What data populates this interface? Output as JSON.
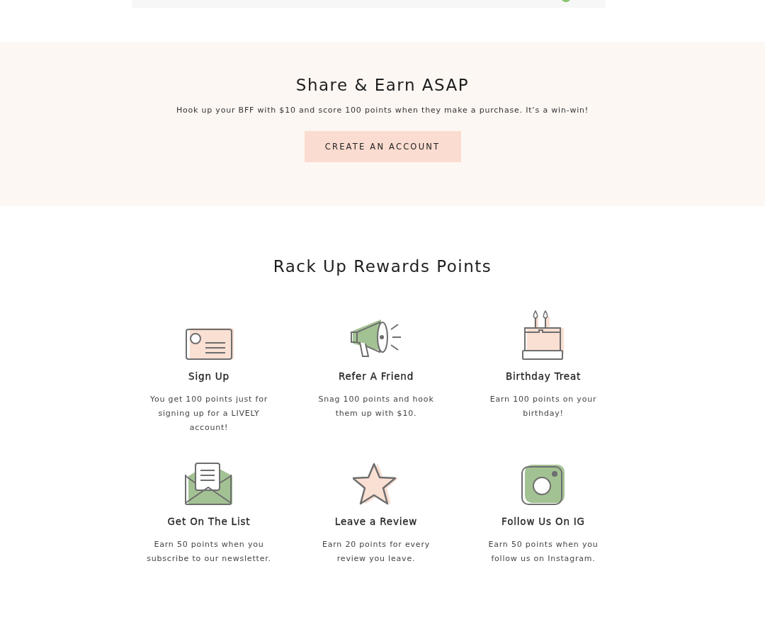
{
  "share": {
    "title": "Share & Earn ASAP",
    "text": "Hook up your BFF with $10 and score 100 points when they make a purchase. It’s a win-win!",
    "button": "CREATE AN ACCOUNT"
  },
  "rewards": {
    "title": "Rack Up Rewards Points",
    "items": [
      {
        "kind": "card",
        "title": "Sign Up",
        "text": "You get 100 points just for signing up for a LIVELY account!"
      },
      {
        "kind": "megaphone",
        "title": "Refer A Friend",
        "text": "Snag 100 points and hook them up with $10."
      },
      {
        "kind": "cake",
        "title": "Birthday Treat",
        "text": "Earn 100 points on your birthday!"
      },
      {
        "kind": "envelope",
        "title": "Get On The List",
        "text": "Earn 50 points when you subscribe to our newsletter."
      },
      {
        "kind": "star",
        "title": "Leave a Review",
        "text": "Earn 20 points for every review you leave."
      },
      {
        "kind": "camera",
        "title": "Follow Us On IG",
        "text": "Earn 50 points when you follow us on Instagram."
      }
    ]
  }
}
